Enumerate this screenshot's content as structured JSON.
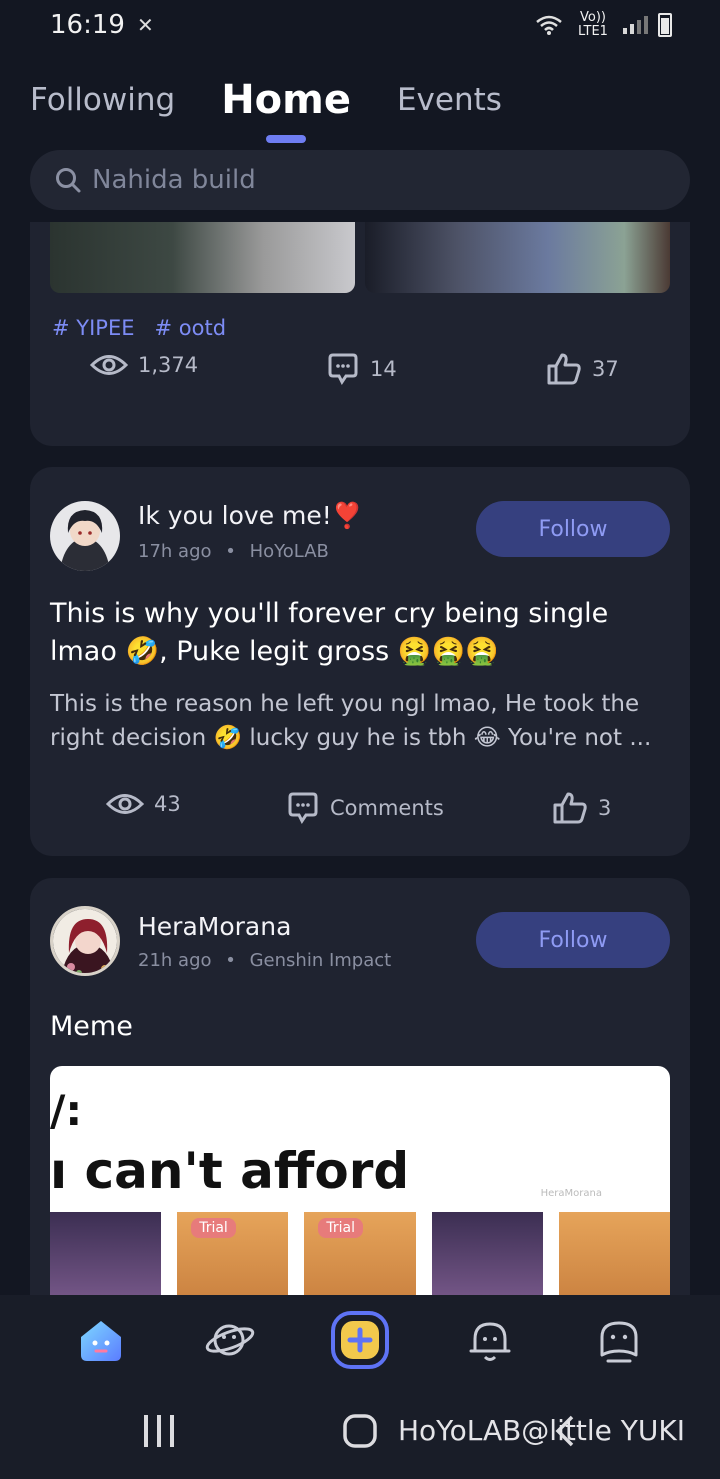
{
  "status_bar": {
    "time": "16:19",
    "network": "Vo)) LTE1"
  },
  "tabs": [
    {
      "label": "Following",
      "active": false
    },
    {
      "label": "Home",
      "active": true
    },
    {
      "label": "Events",
      "active": false
    }
  ],
  "search": {
    "placeholder": "Nahida build"
  },
  "post1": {
    "tags": [
      "# YIPEE",
      "# ootd"
    ],
    "views": "1,374",
    "comments": "14",
    "likes": "37"
  },
  "post2": {
    "author": "Ik you love me!❣️",
    "time": "17h ago",
    "source": "HoYoLAB",
    "follow_label": "Follow",
    "title_line1": "This is why you'll forever cry being single",
    "title_line2": "lmao 🤣, Puke legit gross 🤮🤮🤮",
    "body_line1": "This is the reason he left you ngl lmao, He took the",
    "body_line2": "right decision 🤣 lucky guy he is tbh 😂 You're not ...",
    "views": "43",
    "comments": "Comments",
    "likes": "3"
  },
  "post3": {
    "author": "HeraMorana",
    "time": "21h ago",
    "source": "Genshin Impact",
    "follow_label": "Follow",
    "title": "Meme",
    "meme_line1": "/:",
    "meme_line2": "ı can't afford",
    "meme_watermark": "HeraMorana",
    "trial_badge": "Trial"
  },
  "nav_icons": [
    "home-icon",
    "explore-icon",
    "create-post-icon",
    "notifications-icon",
    "profile-icon"
  ],
  "watermark": "HoYoLAB@little YUKI",
  "colors": {
    "background": "#131722",
    "card": "#1f2330",
    "accent": "#6e7df2",
    "follow_bg": "#36407f",
    "follow_text": "#8f9bf4",
    "tag": "#7d8cf5"
  }
}
